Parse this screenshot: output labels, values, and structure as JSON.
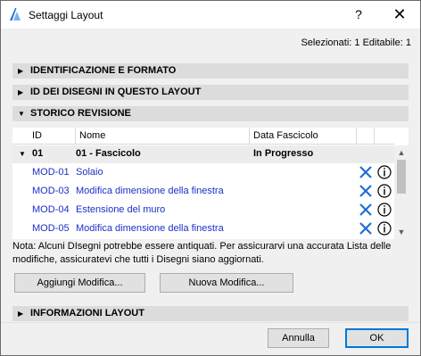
{
  "window": {
    "title": "Settaggi Layout",
    "help_label": "?",
    "close_label": "✕"
  },
  "selection_info": "Selezionati: 1 Editabile: 1",
  "sections": {
    "identificazione": "IDENTIFICAZIONE E FORMATO",
    "id_disegni": "ID DEI DISEGNI IN QUESTO LAYOUT",
    "storico": "STORICO REVISIONE",
    "informazioni": "INFORMAZIONI LAYOUT"
  },
  "table": {
    "headers": [
      "ID",
      "Nome",
      "Data Fascicolo"
    ],
    "group": {
      "id": "01",
      "name": "01 - Fascicolo",
      "status": "In Progresso"
    },
    "rows": [
      {
        "id": "MOD-01",
        "name": "Solaio"
      },
      {
        "id": "MOD-03",
        "name": "Modifica dimensione della finestra"
      },
      {
        "id": "MOD-04",
        "name": "Estensione del muro"
      },
      {
        "id": "MOD-05",
        "name": "Modifica dimensione della finestra"
      }
    ]
  },
  "note": "Nota: Alcuni DIsegni potrebbe essere antiquati. Per assicurarvi una accurata Lista delle modifiche, assicuratevi che tutti i Disegni siano aggiornati.",
  "buttons": {
    "aggiungi": "Aggiungi Modifica...",
    "nuova": "Nuova Modifica...",
    "annulla": "Annulla",
    "ok": "OK"
  },
  "colors": {
    "link_blue": "#1b2fc9",
    "icon_blue": "#1f6fd6",
    "accent": "#0078d7"
  }
}
